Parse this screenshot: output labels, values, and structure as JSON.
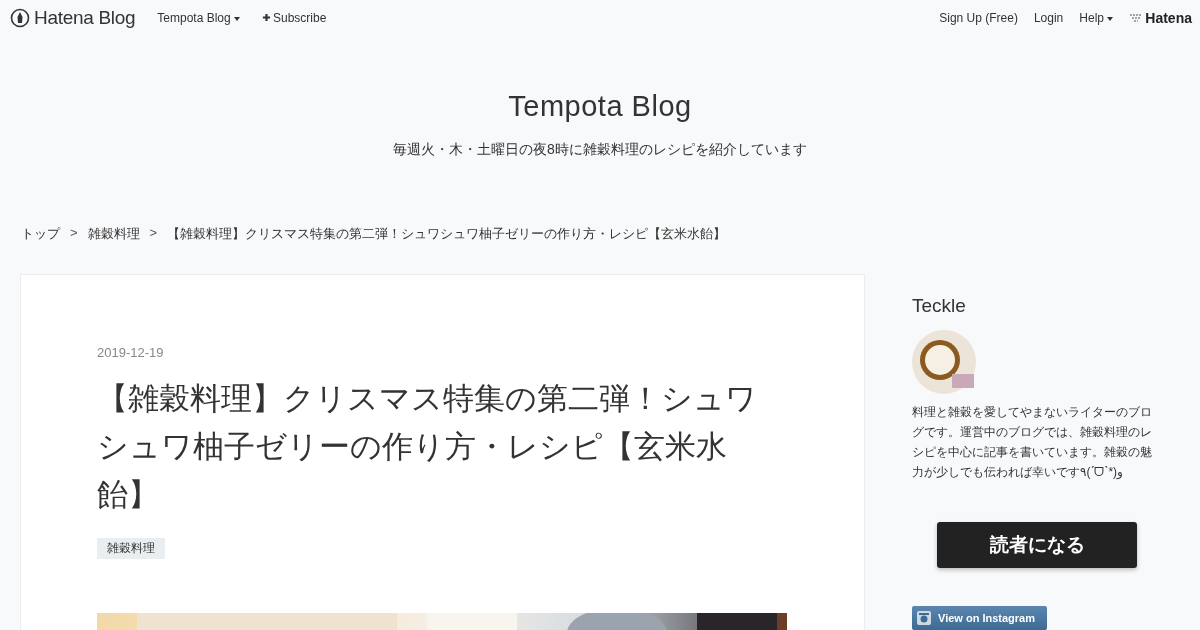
{
  "top_bar": {
    "logo": "Hatena Blog",
    "blog_menu": "Tempota Blog",
    "subscribe": "Subscribe",
    "sign_up": "Sign Up (Free)",
    "login": "Login",
    "help": "Help",
    "hatena": "Hatena"
  },
  "header": {
    "title": "Tempota Blog",
    "tagline": "毎週火・木・土曜日の夜8時に雑穀料理のレシピを紹介しています"
  },
  "breadcrumbs": [
    {
      "label": "トップ"
    },
    {
      "label": "雑穀料理"
    },
    {
      "label": "【雑穀料理】クリスマス特集の第二弾！シュワシュワ柚子ゼリーの作り方・レシピ【玄米水飴】"
    }
  ],
  "breadcrumb_separator": ">",
  "article": {
    "date": "2019-12-19",
    "title": "【雑穀料理】クリスマス特集の第二弾！シュワシュワ柚子ゼリーの作り方・レシピ【玄米水飴】",
    "category": "雑穀料理"
  },
  "sidebar": {
    "name": "Teckle",
    "bio": "料理と雑穀を愛してやまないライターのブログです。運営中のブログでは、雑穀料理のレシピを中心に記事を書いています。雑穀の魅力が少しでも伝われば幸いです٩(ˊᗜˋ*)و",
    "subscribe_button": "読者になる",
    "instagram_button": "View on Instagram"
  }
}
